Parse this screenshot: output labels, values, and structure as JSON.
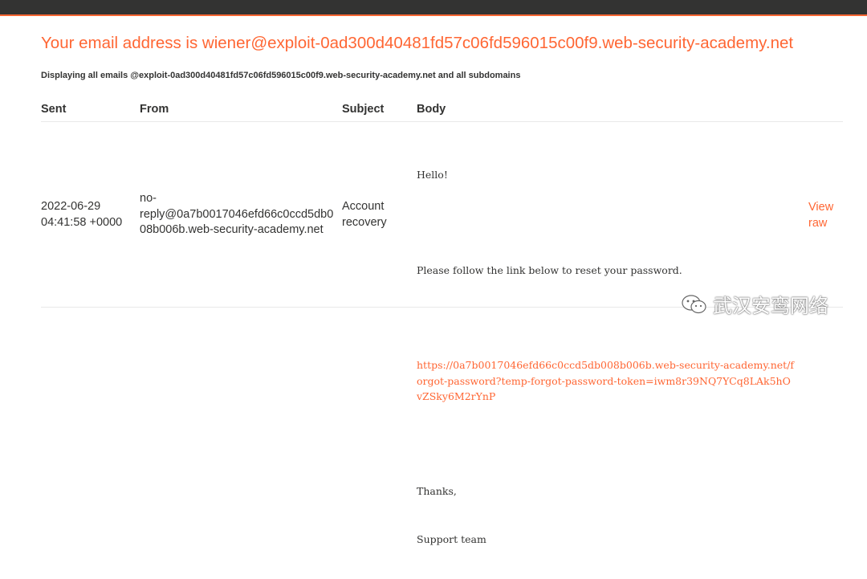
{
  "header": {
    "title": "Your email address is wiener@exploit-0ad300d40481fd57c06fd596015c00f9.web-security-academy.net",
    "subtitle": "Displaying all emails @exploit-0ad300d40481fd57c06fd596015c00f9.web-security-academy.net and all subdomains"
  },
  "table": {
    "columns": [
      "Sent",
      "From",
      "Subject",
      "Body"
    ],
    "rows": [
      {
        "sent_date": "2022-06-29",
        "sent_time": "04:41:58 +0000",
        "from_line1": "no-",
        "from_line2": "reply@0a7b0017046efd66c0ccd5db0",
        "from_line3": "08b006b.web-security-academy.net",
        "subject_line1": "Account",
        "subject_line2": "recovery",
        "body_greeting": "Hello!",
        "body_instruction": "Please follow the link below to reset your password.",
        "body_link": "https://0a7b0017046efd66c0ccd5db008b006b.web-security-academy.net/forgot-password?temp-forgot-password-token=iwm8r39NQ7YCq8LAk5hOvZSky6M2rYnP",
        "body_thanks": "Thanks,",
        "body_signature": "Support team",
        "view_raw_line1": "View",
        "view_raw_line2": "raw"
      }
    ]
  },
  "watermark": {
    "text": "武汉安鸾网络",
    "icon": "wechat-icon"
  },
  "colors": {
    "accent": "#ff6633",
    "dark": "#333332",
    "rule": "#e8e8e8"
  }
}
